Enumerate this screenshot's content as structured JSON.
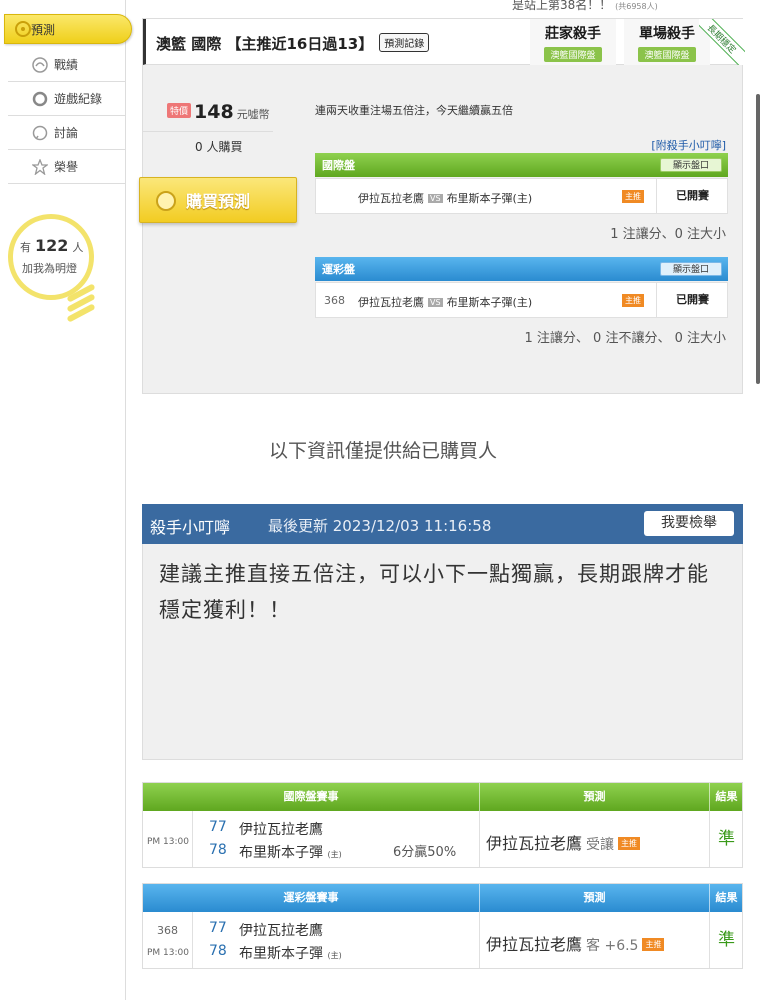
{
  "top_cut": {
    "text": "是站上第38名！！",
    "small": "(共6958人)"
  },
  "sidebar": {
    "items": [
      {
        "label": "預測",
        "icon": "target-icon",
        "active": true
      },
      {
        "label": "戰績",
        "icon": "record-icon"
      },
      {
        "label": "遊戲紀錄",
        "icon": "circle-icon"
      },
      {
        "label": "討論",
        "icon": "chat-icon"
      },
      {
        "label": "榮譽",
        "icon": "medal-icon"
      }
    ],
    "bulb": {
      "prefix": "有",
      "count": "122",
      "suffix": "人",
      "line2": "加我為明燈"
    }
  },
  "header": {
    "title": "澳籃 國際 【主推近16日過13】",
    "history_button": "預測記錄",
    "badges": [
      {
        "title": "莊家殺手",
        "ribbon": "澳籃國際盤"
      },
      {
        "title": "單場殺手",
        "ribbon": "澳籃國際盤"
      }
    ],
    "corner_ribbon": "長期穩定"
  },
  "purchase": {
    "tag": "特價",
    "price": "148",
    "unit": "元噓幣",
    "buyers": "0 人購買",
    "buy_button": "購買預測"
  },
  "description": "連兩天收重注場五倍注，今天繼續贏五倍",
  "attach_tip_link": "[附殺手小叮嚀]",
  "intl": {
    "header": "國際盤",
    "show_button": "顯示盤口",
    "match": {
      "num": "",
      "away": "伊拉瓦拉老鷹",
      "vs": "VS",
      "home": "布里斯本子彈(主)",
      "tag": "主推",
      "status": "已開賽"
    },
    "summary": "1 注讓分、0 注大小"
  },
  "lottery": {
    "header": "運彩盤",
    "show_button": "顯示盤口",
    "match": {
      "num": "368",
      "away": "伊拉瓦拉老鷹",
      "vs": "VS",
      "home": "布里斯本子彈(主)",
      "tag": "主推",
      "status": "已開賽"
    },
    "summary": "1 注讓分、 0 注不讓分、 0 注大小"
  },
  "notice": "以下資訊僅提供給已購買人",
  "tip": {
    "title": "殺手小叮嚀",
    "updated": "最後更新 2023/12/03 11:16:58",
    "report_button": "我要檢舉",
    "body": "建議主推直接五倍注，可以小下一點獨贏，長期跟牌才能穩定獲利！！"
  },
  "table_intl": {
    "headers": [
      "國際盤賽事",
      "預測",
      "結果"
    ],
    "row": {
      "num": "",
      "time": "PM 13:00",
      "team1_num": "77",
      "team1": "伊拉瓦拉老鷹",
      "team2_num": "78",
      "team2": "布里斯本子彈",
      "home_mark": "(主)",
      "odds": "6分贏50%",
      "pred_team": "伊拉瓦拉老鷹",
      "pred_type": "受讓",
      "pred_tag": "主推",
      "result": "準"
    }
  },
  "table_lottery": {
    "headers": [
      "運彩盤賽事",
      "預測",
      "結果"
    ],
    "row": {
      "num": "368",
      "time": "PM 13:00",
      "team1_num": "77",
      "team1": "伊拉瓦拉老鷹",
      "team2_num": "78",
      "team2": "布里斯本子彈",
      "home_mark": "(主)",
      "pred_team": "伊拉瓦拉老鷹",
      "pred_type": "客 +6.5",
      "pred_tag": "主推",
      "result": "準"
    }
  },
  "colors": {
    "green": "#6cb52e",
    "blue": "#3a8fd6",
    "tip_header": "#3a6aa0",
    "gold": "#f2cc22"
  }
}
